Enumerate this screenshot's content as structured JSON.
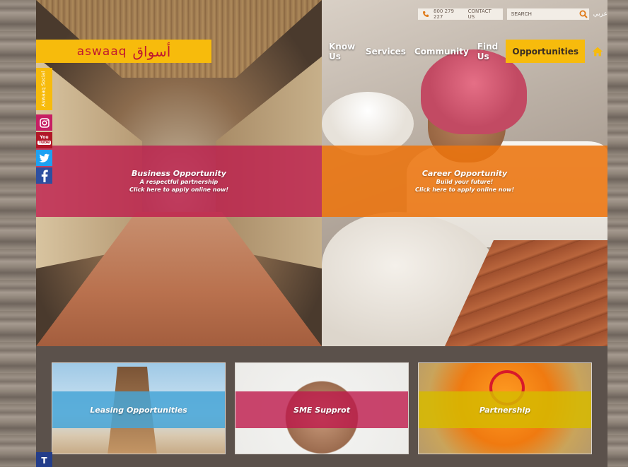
{
  "utility": {
    "phone": "800 279 227",
    "contact_label": "CONTACT US",
    "search_placeholder": "SEARCH",
    "language_link": "عربي"
  },
  "logo": {
    "latin": "aswaaq",
    "arabic": "أسواق"
  },
  "nav": {
    "items": [
      {
        "label": "Know Us"
      },
      {
        "label": "Services"
      },
      {
        "label": "Community"
      },
      {
        "label": "Find Us"
      },
      {
        "label": "Opportunities",
        "active": true
      }
    ],
    "home_icon": "home-icon"
  },
  "social": {
    "tab_label": "Aswaaq Social",
    "youtube_top": "You",
    "youtube_bottom": "Tube"
  },
  "hero": {
    "business": {
      "title": "Business Opportunity",
      "line1": "A respectful partnership",
      "line2": "Click here to apply online now!"
    },
    "career": {
      "title": "Career Opportunity",
      "line1": "Build your future!",
      "line2": "Click here to apply online now!"
    }
  },
  "tiles": [
    {
      "label": "Leasing Opportunities"
    },
    {
      "label": "SME Supprot"
    },
    {
      "label": "Partnership"
    }
  ],
  "colors": {
    "accent_yellow": "#f7bb0c",
    "brand_red": "#c0182f",
    "magenta_band": "#be194b",
    "orange_band": "#ec740e"
  }
}
